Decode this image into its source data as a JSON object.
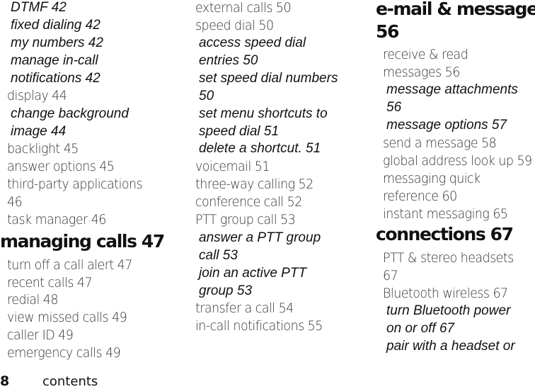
{
  "page": {
    "number": "8",
    "section_label": "contents"
  },
  "columns": [
    {
      "entries": [
        {
          "type": "sub",
          "text": "DTMF 42"
        },
        {
          "type": "sub",
          "text": "fixed dialing 42"
        },
        {
          "type": "sub",
          "text": "my numbers 42"
        },
        {
          "type": "sub",
          "text": "manage in-call"
        },
        {
          "type": "sub",
          "text": "notifications 42"
        },
        {
          "type": "plain",
          "text": "display 44"
        },
        {
          "type": "sub",
          "text": "change background"
        },
        {
          "type": "sub",
          "text": "image 44"
        },
        {
          "type": "plain",
          "text": "backlight 45"
        },
        {
          "type": "plain",
          "text": "answer options 45"
        },
        {
          "type": "plain",
          "text": "third-party applications"
        },
        {
          "type": "plain",
          "text": "46"
        },
        {
          "type": "plain",
          "text": "task manager 46"
        },
        {
          "type": "head",
          "text": "managing calls 47"
        },
        {
          "type": "plain",
          "text": "turn off a call alert 47"
        },
        {
          "type": "plain",
          "text": "recent calls 47"
        },
        {
          "type": "plain",
          "text": "redial 48"
        },
        {
          "type": "plain",
          "text": "view missed calls 49"
        },
        {
          "type": "plain",
          "text": "caller ID 49"
        },
        {
          "type": "plain",
          "text": "emergency calls 49"
        }
      ]
    },
    {
      "entries": [
        {
          "type": "plain",
          "text": "external calls 50"
        },
        {
          "type": "plain",
          "text": "speed dial 50"
        },
        {
          "type": "sub",
          "text": "access speed dial"
        },
        {
          "type": "sub",
          "text": "entries 50"
        },
        {
          "type": "sub",
          "text": "set speed dial numbers"
        },
        {
          "type": "sub",
          "text": "50"
        },
        {
          "type": "sub",
          "text": "set menu shortcuts to"
        },
        {
          "type": "sub",
          "text": "speed dial 51"
        },
        {
          "type": "sub",
          "text": "delete a shortcut. 51"
        },
        {
          "type": "plain",
          "text": "voicemail 51"
        },
        {
          "type": "plain",
          "text": "three-way calling 52"
        },
        {
          "type": "plain",
          "text": "conference call 52"
        },
        {
          "type": "plain",
          "text": "PTT group call 53"
        },
        {
          "type": "sub",
          "text": "answer a PTT group"
        },
        {
          "type": "sub",
          "text": "call 53"
        },
        {
          "type": "sub",
          "text": "join an active PTT"
        },
        {
          "type": "sub",
          "text": "group 53"
        },
        {
          "type": "plain",
          "text": "transfer a call 54"
        },
        {
          "type": "plain",
          "text": "in-call notifications 55"
        }
      ]
    },
    {
      "entries": [
        {
          "type": "head",
          "text": "e-mail & messages"
        },
        {
          "type": "head",
          "text": "56"
        },
        {
          "type": "plain",
          "text": "receive & read"
        },
        {
          "type": "plain",
          "text": "messages 56"
        },
        {
          "type": "sub",
          "text": "message attachments"
        },
        {
          "type": "sub",
          "text": "56"
        },
        {
          "type": "sub",
          "text": "message options 57"
        },
        {
          "type": "plain",
          "text": "send a message 58"
        },
        {
          "type": "plain",
          "text": "global address look up 59"
        },
        {
          "type": "plain",
          "text": "messaging quick"
        },
        {
          "type": "plain",
          "text": "reference 60"
        },
        {
          "type": "plain",
          "text": "instant messaging 65"
        },
        {
          "type": "head",
          "text": "connections 67"
        },
        {
          "type": "plain",
          "text": "PTT & stereo headsets"
        },
        {
          "type": "plain",
          "text": "67"
        },
        {
          "type": "plain",
          "text": "Bluetooth    wireless 67"
        },
        {
          "type": "sub",
          "text": "turn Bluetooth power"
        },
        {
          "type": "sub",
          "text": "on or off 67"
        },
        {
          "type": "sub",
          "text": "pair with a headset or"
        }
      ]
    }
  ]
}
